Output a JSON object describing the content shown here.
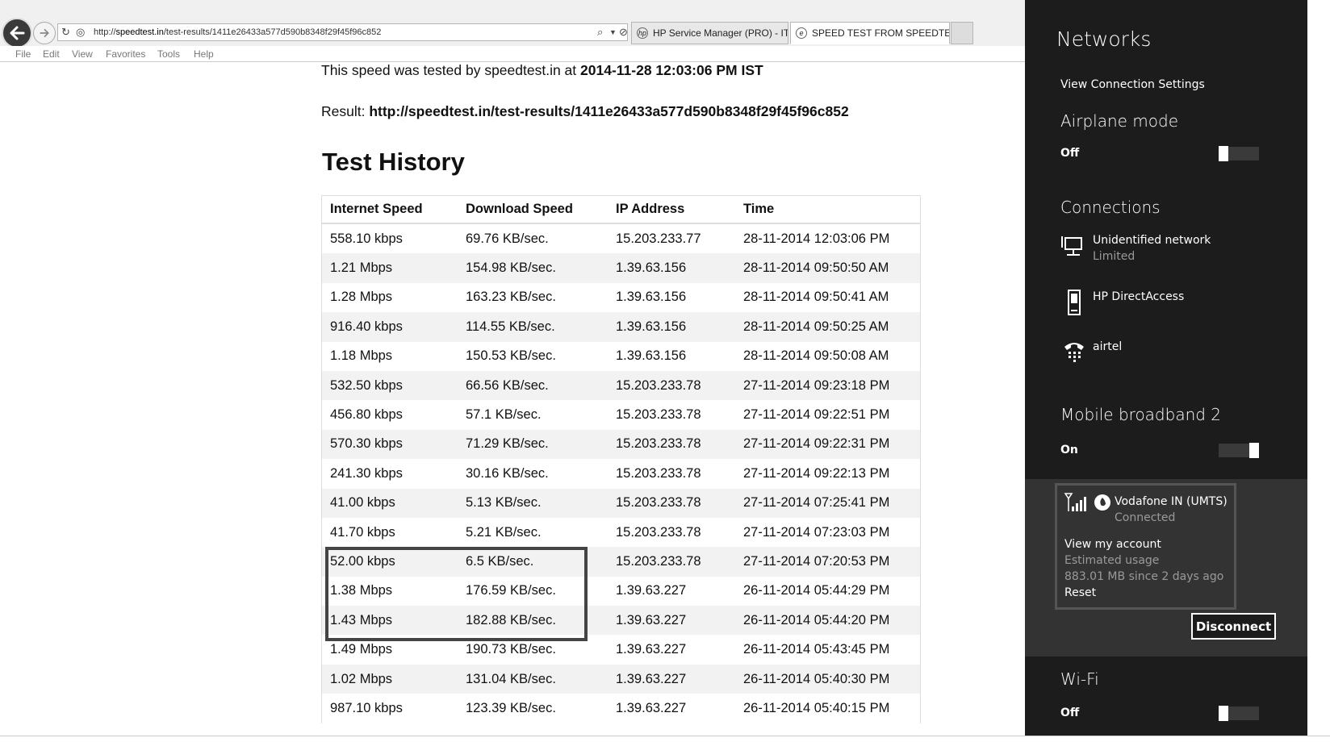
{
  "browser": {
    "url_prefix": "http://",
    "url_domain": "speedtest.in",
    "url_path": "/test-results/1411e26433a577d590b8348f29f45f96c852",
    "tabs": [
      {
        "label": "HP Service Manager (PRO) - IT...",
        "active": false
      },
      {
        "label": "SPEED TEST FROM SPEEDTE...",
        "active": true
      }
    ],
    "menu": [
      "File",
      "Edit",
      "View",
      "Favorites",
      "Tools",
      "Help"
    ]
  },
  "page": {
    "tested_prefix": "This speed was tested by speedtest.in at ",
    "tested_time": "2014-11-28 12:03:06 PM IST",
    "result_label": "Result: ",
    "result_url": "http://speedtest.in/test-results/1411e26433a577d590b8348f29f45f96c852",
    "history_title": "Test History",
    "table": {
      "headers": [
        "Internet Speed",
        "Download Speed",
        "IP Address",
        "Time"
      ],
      "rows": [
        [
          "558.10 kbps",
          "69.76 KB/sec.",
          "15.203.233.77",
          "28-11-2014 12:03:06 PM"
        ],
        [
          "1.21 Mbps",
          "154.98 KB/sec.",
          "1.39.63.156",
          "28-11-2014 09:50:50 AM"
        ],
        [
          "1.28 Mbps",
          "163.23 KB/sec.",
          "1.39.63.156",
          "28-11-2014 09:50:41 AM"
        ],
        [
          "916.40 kbps",
          "114.55 KB/sec.",
          "1.39.63.156",
          "28-11-2014 09:50:25 AM"
        ],
        [
          "1.18 Mbps",
          "150.53 KB/sec.",
          "1.39.63.156",
          "28-11-2014 09:50:08 AM"
        ],
        [
          "532.50 kbps",
          "66.56 KB/sec.",
          "15.203.233.78",
          "27-11-2014 09:23:18 PM"
        ],
        [
          "456.80 kbps",
          "57.1 KB/sec.",
          "15.203.233.78",
          "27-11-2014 09:22:51 PM"
        ],
        [
          "570.30 kbps",
          "71.29 KB/sec.",
          "15.203.233.78",
          "27-11-2014 09:22:31 PM"
        ],
        [
          "241.30 kbps",
          "30.16 KB/sec.",
          "15.203.233.78",
          "27-11-2014 09:22:13 PM"
        ],
        [
          "41.00 kbps",
          "5.13 KB/sec.",
          "15.203.233.78",
          "27-11-2014 07:25:41 PM"
        ],
        [
          "41.70 kbps",
          "5.21 KB/sec.",
          "15.203.233.78",
          "27-11-2014 07:23:03 PM"
        ],
        [
          "52.00 kbps",
          "6.5 KB/sec.",
          "15.203.233.78",
          "27-11-2014 07:20:53 PM"
        ],
        [
          "1.38 Mbps",
          "176.59 KB/sec.",
          "1.39.63.227",
          "26-11-2014 05:44:29 PM"
        ],
        [
          "1.43 Mbps",
          "182.88 KB/sec.",
          "1.39.63.227",
          "26-11-2014 05:44:20 PM"
        ],
        [
          "1.49 Mbps",
          "190.73 KB/sec.",
          "1.39.63.227",
          "26-11-2014 05:43:45 PM"
        ],
        [
          "1.02 Mbps",
          "131.04 KB/sec.",
          "1.39.63.227",
          "26-11-2014 05:40:30 PM"
        ],
        [
          "987.10 kbps",
          "123.39 KB/sec.",
          "1.39.63.227",
          "26-11-2014 05:40:15 PM"
        ]
      ]
    }
  },
  "networks": {
    "title": "Networks",
    "view_settings": "View Connection Settings",
    "airplane": {
      "heading": "Airplane mode",
      "state": "Off"
    },
    "connections": {
      "heading": "Connections",
      "items": [
        {
          "name": "Unidentified network",
          "status": "Limited",
          "icon": "wired-network-icon"
        },
        {
          "name": "HP DirectAccess",
          "status": "",
          "icon": "phone-device-icon"
        },
        {
          "name": "airtel",
          "status": "",
          "icon": "dialup-phone-icon"
        }
      ]
    },
    "mobile_broadband": {
      "heading": "Mobile broadband 2",
      "state": "On",
      "carrier": "Vodafone IN (UMTS)",
      "carrier_status": "Connected",
      "view_account": "View my account",
      "estimated_usage": "Estimated usage",
      "usage": "883.01 MB since 2 days ago",
      "reset": "Reset",
      "disconnect_label": "Disconnect"
    },
    "wifi": {
      "heading": "Wi-Fi",
      "state": "Off"
    }
  }
}
